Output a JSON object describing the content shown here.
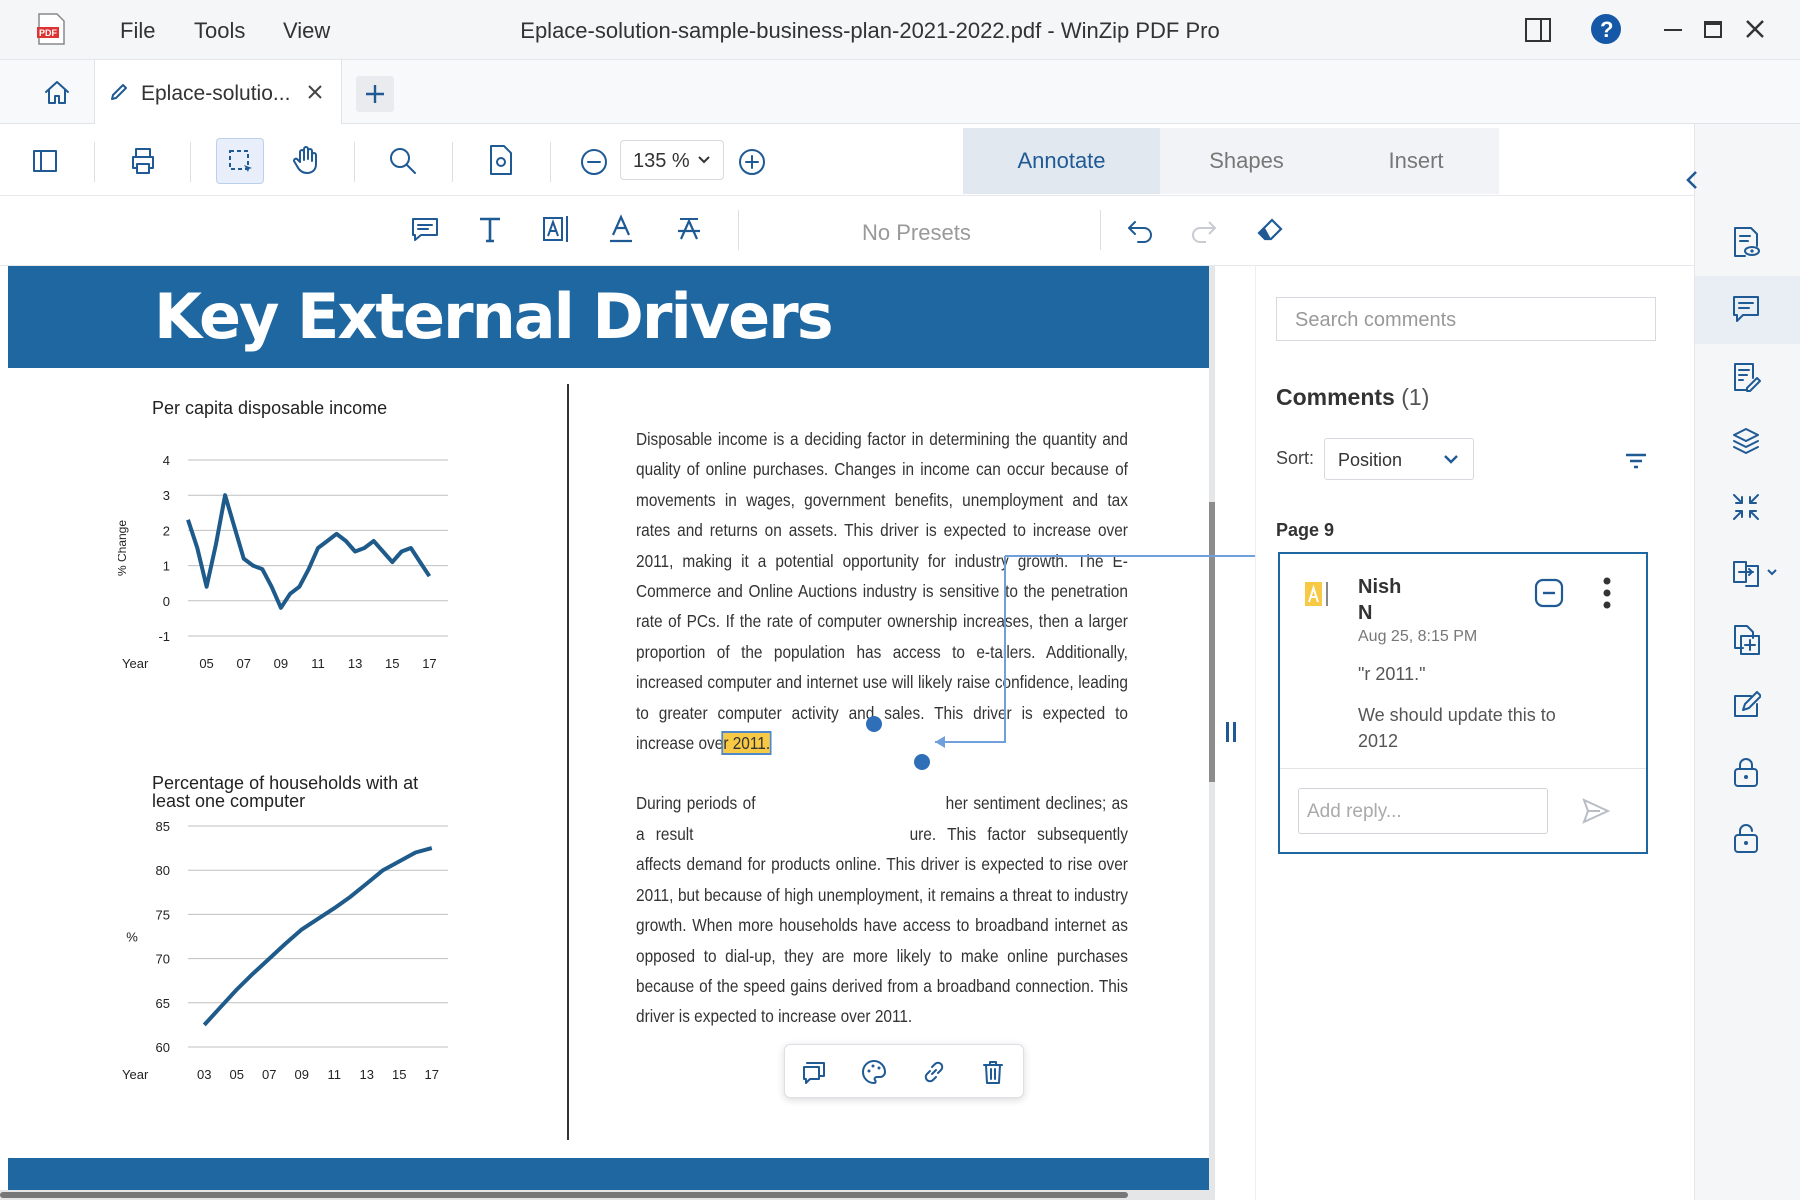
{
  "window": {
    "title_file": "Eplace-solution-sample-business-plan-2021-2022.pdf",
    "title_sep": " - ",
    "title_app": "WinZip PDF Pro"
  },
  "menu": [
    "File",
    "Tools",
    "View"
  ],
  "tab": {
    "label": "Eplace-solutio..."
  },
  "toolbar": {
    "zoom": "135 %",
    "modes": [
      "Annotate",
      "Shapes",
      "Insert"
    ]
  },
  "annotate": {
    "presets": "No Presets"
  },
  "page": {
    "heading": "Key External Drivers",
    "para1_before": "Disposable income is a deciding factor in determining the quantity and quality of online purchases. Changes in income can occur because of movements in wages, government benefits, unemployment and tax rates and returns on assets. This driver is expected to increase over 2011, making it a potential opportunity for industry growth. The E-Commerce and Online Auctions industry is sensitive to the penetration rate of PCs. If the rate of computer ownership increases, then a larger proportion of the population has access to e-tailers. Additionally, increased computer and internet use will likely raise confidence, leading to greater computer activity and sales. This driver is expected to increase ove",
    "para1_highlight": "r 2011.",
    "para2_start": "During periods of",
    "para2_mid": "her sentiment declines; as a result",
    "para2_rest": "ure. This factor subsequently affects demand for products online. This driver is expected to rise over 2011, but because of high unemployment, it remains a threat to industry growth.  When more households have access to broadband internet as opposed to dial-up, they are more likely to make online purchases because of the speed gains derived from a broadband connection. This driver is expected to increase over 2011."
  },
  "chart_data": [
    {
      "type": "line",
      "title": "Per capita disposable income",
      "xlabel": "Year",
      "ylabel": "% Change",
      "x": [
        2004,
        2004.5,
        2005,
        2005.5,
        2006,
        2006.5,
        2007,
        2007.5,
        2008,
        2008.5,
        2009,
        2009.5,
        2010,
        2010.5,
        2011,
        2011.5,
        2012,
        2012.5,
        2013,
        2013.5,
        2014,
        2014.5,
        2015,
        2015.5,
        2016,
        2016.5,
        2017
      ],
      "y": [
        2.3,
        1.5,
        0.4,
        1.6,
        3.0,
        2.1,
        1.2,
        1.0,
        0.9,
        0.4,
        -0.2,
        0.2,
        0.4,
        0.9,
        1.5,
        1.7,
        1.9,
        1.7,
        1.4,
        1.5,
        1.7,
        1.4,
        1.1,
        1.4,
        1.5,
        1.1,
        0.7
      ],
      "xticks": [
        "05",
        "07",
        "09",
        "11",
        "13",
        "15",
        "17"
      ],
      "xtick_values": [
        2005,
        2007,
        2009,
        2011,
        2013,
        2015,
        2017
      ],
      "yticks": [
        "4",
        "3",
        "2",
        "1",
        "0",
        "-1"
      ],
      "ylim": [
        -1,
        4
      ],
      "xlim": [
        2004,
        2018
      ],
      "grid": true,
      "color": "#1e5a8a"
    },
    {
      "type": "line",
      "title": "Percentage of households with at least one computer",
      "xlabel": "Year",
      "ylabel": "%",
      "x": [
        2003,
        2004,
        2005,
        2006,
        2007,
        2008,
        2009,
        2010,
        2011,
        2012,
        2013,
        2014,
        2015,
        2016,
        2017
      ],
      "y": [
        62.5,
        64.5,
        66.5,
        68.3,
        70,
        71.7,
        73.3,
        74.5,
        75.7,
        77,
        78.5,
        80,
        81,
        82,
        82.5
      ],
      "xticks": [
        "03",
        "05",
        "07",
        "09",
        "11",
        "13",
        "15",
        "17"
      ],
      "xtick_values": [
        2003,
        2005,
        2007,
        2009,
        2011,
        2013,
        2015,
        2017
      ],
      "yticks": [
        "85",
        "80",
        "75",
        "70",
        "65",
        "60"
      ],
      "ylim": [
        60,
        85
      ],
      "xlim": [
        2002,
        2018
      ],
      "grid": true,
      "color": "#1e5a8a"
    }
  ],
  "comments": {
    "search_placeholder": "Search comments",
    "title": "Comments",
    "count": "(1)",
    "sort_label": "Sort:",
    "sort_value": "Position",
    "page_label": "Page 9",
    "item": {
      "author_first": "Nish",
      "author_last": "N",
      "date": "Aug 25, 8:15 PM",
      "quote": "\"r 2011.\"",
      "text": "We should update this to 2012"
    },
    "reply_placeholder": "Add reply..."
  },
  "colors": {
    "accent": "#1e67a0",
    "highlight": "#f7c944",
    "icon": "#1f5a94"
  }
}
